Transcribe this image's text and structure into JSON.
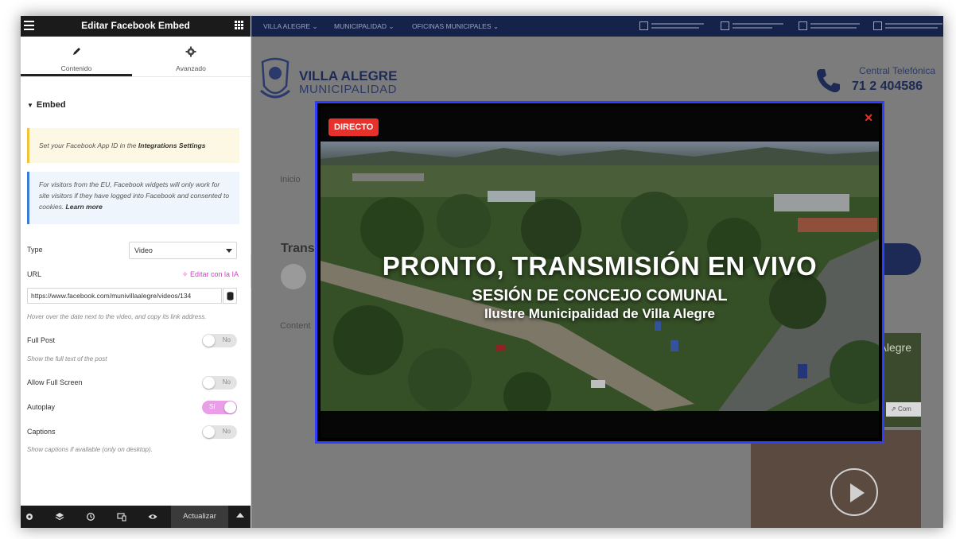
{
  "editor": {
    "title": "Editar Facebook Embed",
    "tabs": [
      {
        "label": "Contenido"
      },
      {
        "label": "Avanzado"
      }
    ],
    "section_title": "Embed",
    "notice_warn": {
      "text": "Set your Facebook App ID in the ",
      "link": "Integrations Settings"
    },
    "notice_info": {
      "text": "For visitors from the EU, Facebook widgets will only work for site visitors if they have logged into Facebook and consented to cookies. ",
      "link": "Learn more"
    },
    "type": {
      "label": "Type",
      "value": "Video"
    },
    "url": {
      "label": "URL",
      "ai_link": "Editar con la IA",
      "value": "https://www.facebook.com/munivillaalegre/videos/134",
      "hint": "Hover over the date next to the video, and copy its link address."
    },
    "full_post": {
      "label": "Full Post",
      "state": "No",
      "hint": "Show the full text of the post"
    },
    "allow_full_screen": {
      "label": "Allow Full Screen",
      "state": "No"
    },
    "autoplay": {
      "label": "Autoplay",
      "state": "Sí"
    },
    "captions": {
      "label": "Captions",
      "state": "No",
      "hint": "Show captions if available (only on desktop)."
    },
    "footer": {
      "update_label": "Actualizar"
    }
  },
  "site": {
    "nav": [
      "VILLA ALEGRE",
      "MUNICIPALIDAD",
      "OFICINAS MUNICIPALES"
    ],
    "brand_line1": "VILLA ALEGRE",
    "brand_line2": "MUNICIPALIDAD",
    "phone_label": "Central Telefónica",
    "phone_number": "71 2 404586",
    "breadcrumb": "Inicio",
    "title_partial": "Trans",
    "content_partial": "Content",
    "thumb_label": "Alegre",
    "thumb_button": "Com"
  },
  "modal": {
    "badge": "DIRECTO",
    "close_glyph": "✕",
    "headline": "PRONTO, TRANSMISIÓN EN VIVO",
    "subtitle": "SESIÓN DE CONCEJO COMUNAL",
    "subtitle2": "Ilustre Municipalidad de Villa Alegre"
  },
  "colors": {
    "modal_border": "#2f3dff",
    "badge": "#e8312a",
    "autoplay_on": "#e99ee8",
    "ai_link": "#d63cc8",
    "topbar": "#15224a"
  }
}
